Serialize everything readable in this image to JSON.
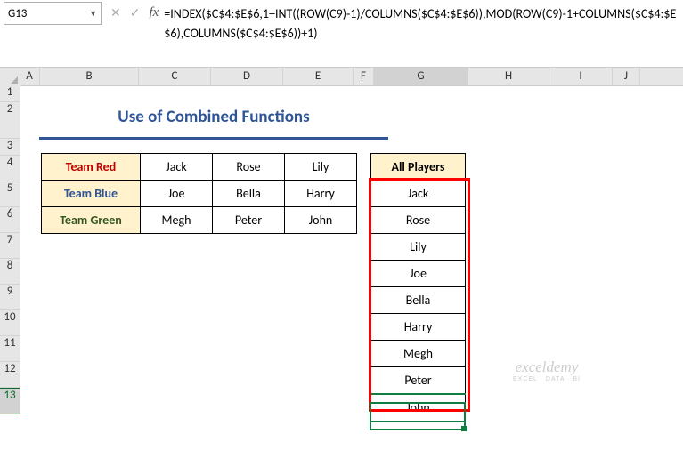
{
  "nameBox": "G13",
  "formula": "=INDEX($C$4:$E$6,1+INT((ROW(C9)-1)/COLUMNS($C$4:$E$6)),MOD(ROW(C9)-1+COLUMNS($C$4:$E$6),COLUMNS($C$4:$E$6))+1)",
  "columns": [
    "A",
    "B",
    "C",
    "D",
    "E",
    "F",
    "G",
    "H",
    "I",
    "J"
  ],
  "rows": [
    "1",
    "2",
    "3",
    "4",
    "5",
    "6",
    "7",
    "8",
    "9",
    "10",
    "11",
    "12",
    "13"
  ],
  "title": "Use of Combined Functions",
  "table1": {
    "rows": [
      {
        "team": "Team Red",
        "p": [
          "Jack",
          "Rose",
          "Lily"
        ]
      },
      {
        "team": "Team Blue",
        "p": [
          "Joe",
          "Bella",
          "Harry"
        ]
      },
      {
        "team": "Team Green",
        "p": [
          "Megh",
          "Peter",
          "John"
        ]
      }
    ]
  },
  "table2": {
    "header": "All Players",
    "values": [
      "Jack",
      "Rose",
      "Lily",
      "Joe",
      "Bella",
      "Harry",
      "Megh",
      "Peter",
      "John"
    ]
  },
  "watermark": {
    "main": "exceldemy",
    "sub": "EXCEL · DATA · BI"
  },
  "chart_data": {
    "type": "table",
    "title": "Use of Combined Functions",
    "source_range": "C4:E6",
    "teams": [
      {
        "name": "Team Red",
        "players": [
          "Jack",
          "Rose",
          "Lily"
        ]
      },
      {
        "name": "Team Blue",
        "players": [
          "Joe",
          "Bella",
          "Harry"
        ]
      },
      {
        "name": "Team Green",
        "players": [
          "Megh",
          "Peter",
          "John"
        ]
      }
    ],
    "flattened_output_header": "All Players",
    "flattened_output": [
      "Jack",
      "Rose",
      "Lily",
      "Joe",
      "Bella",
      "Harry",
      "Megh",
      "Peter",
      "John"
    ],
    "active_cell": "G13",
    "formula": "=INDEX($C$4:$E$6,1+INT((ROW(C9)-1)/COLUMNS($C$4:$E$6)),MOD(ROW(C9)-1+COLUMNS($C$4:$E$6),COLUMNS($C$4:$E$6))+1)"
  }
}
